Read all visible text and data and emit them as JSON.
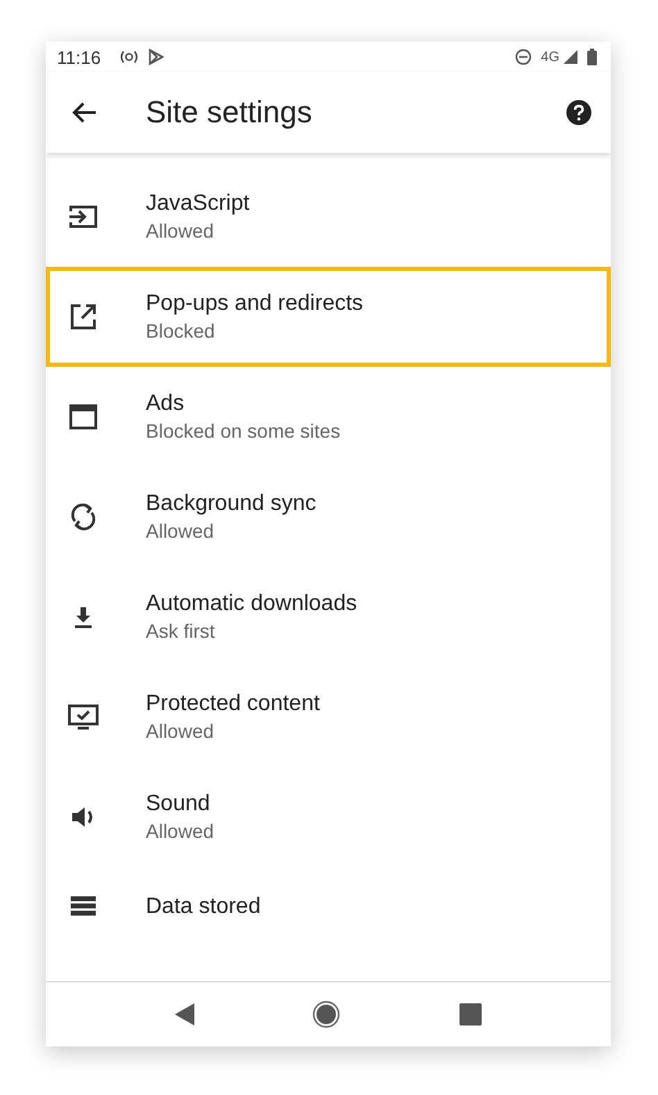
{
  "status_bar": {
    "time": "11:16",
    "network": "4G"
  },
  "app_bar": {
    "title": "Site settings"
  },
  "items": [
    {
      "title": "JavaScript",
      "subtitle": "Allowed",
      "selected": false
    },
    {
      "title": "Pop-ups and redirects",
      "subtitle": "Blocked",
      "selected": true
    },
    {
      "title": "Ads",
      "subtitle": "Blocked on some sites",
      "selected": false
    },
    {
      "title": "Background sync",
      "subtitle": "Allowed",
      "selected": false
    },
    {
      "title": "Automatic downloads",
      "subtitle": "Ask first",
      "selected": false
    },
    {
      "title": "Protected content",
      "subtitle": "Allowed",
      "selected": false
    },
    {
      "title": "Sound",
      "subtitle": "Allowed",
      "selected": false
    },
    {
      "title": "Data stored",
      "selected": false
    }
  ]
}
